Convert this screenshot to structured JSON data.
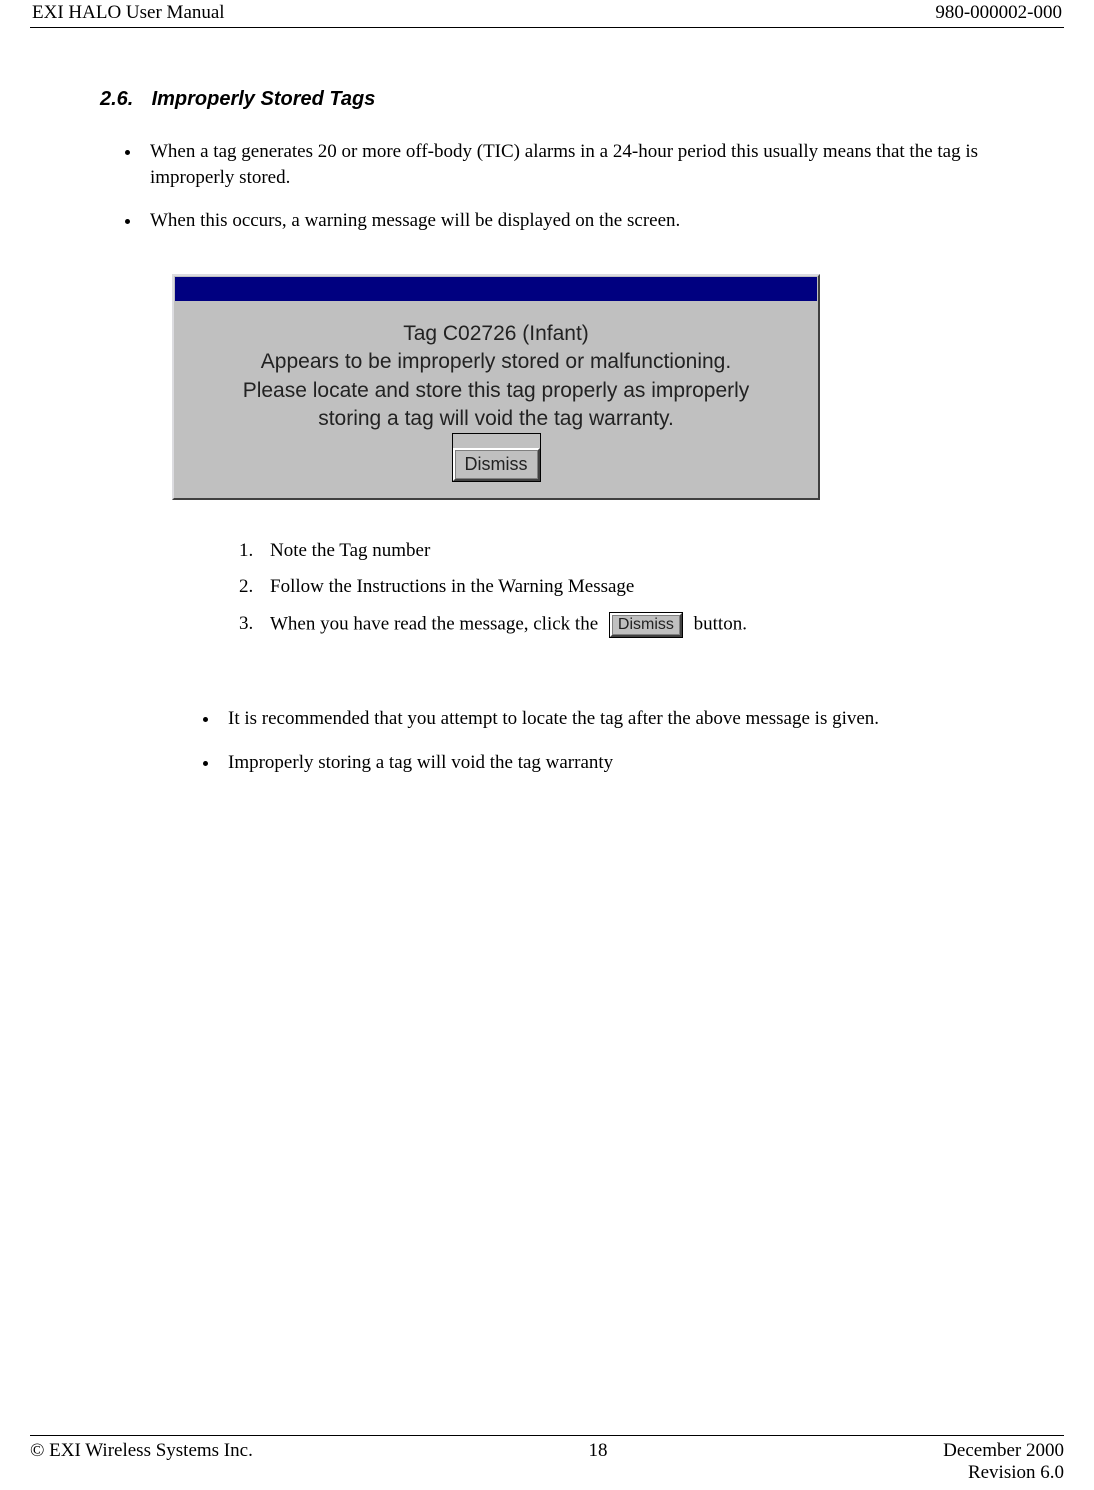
{
  "header": {
    "left": "EXI HALO User Manual",
    "right": "980-000002-000"
  },
  "section": {
    "number": "2.6.",
    "title": "Improperly Stored Tags"
  },
  "bullets_top": [
    "When a tag generates 20 or more off-body (TIC) alarms in a 24-hour period this usually means that the tag is improperly stored.",
    "When this occurs, a warning message will be displayed on the screen."
  ],
  "dialog": {
    "line1": "Tag C02726 (Infant)",
    "line2": "Appears to be improperly stored or malfunctioning.",
    "line3": "Please locate and store this tag properly as improperly",
    "line4": "storing a tag will void the tag warranty.",
    "button": "Dismiss"
  },
  "steps": {
    "s1": "Note the Tag number",
    "s2": "Follow the Instructions in the Warning Message",
    "s3_before": "When you have read the message, click the",
    "s3_button": "Dismiss",
    "s3_after": "button."
  },
  "bullets_bottom": [
    "It is recommended that you attempt to locate the tag after the above message is given.",
    "Improperly storing a tag will void the tag warranty"
  ],
  "footer": {
    "copyright": "© EXI Wireless Systems Inc.",
    "page": "18",
    "date": "December 2000",
    "revision": "Revision 6.0"
  }
}
